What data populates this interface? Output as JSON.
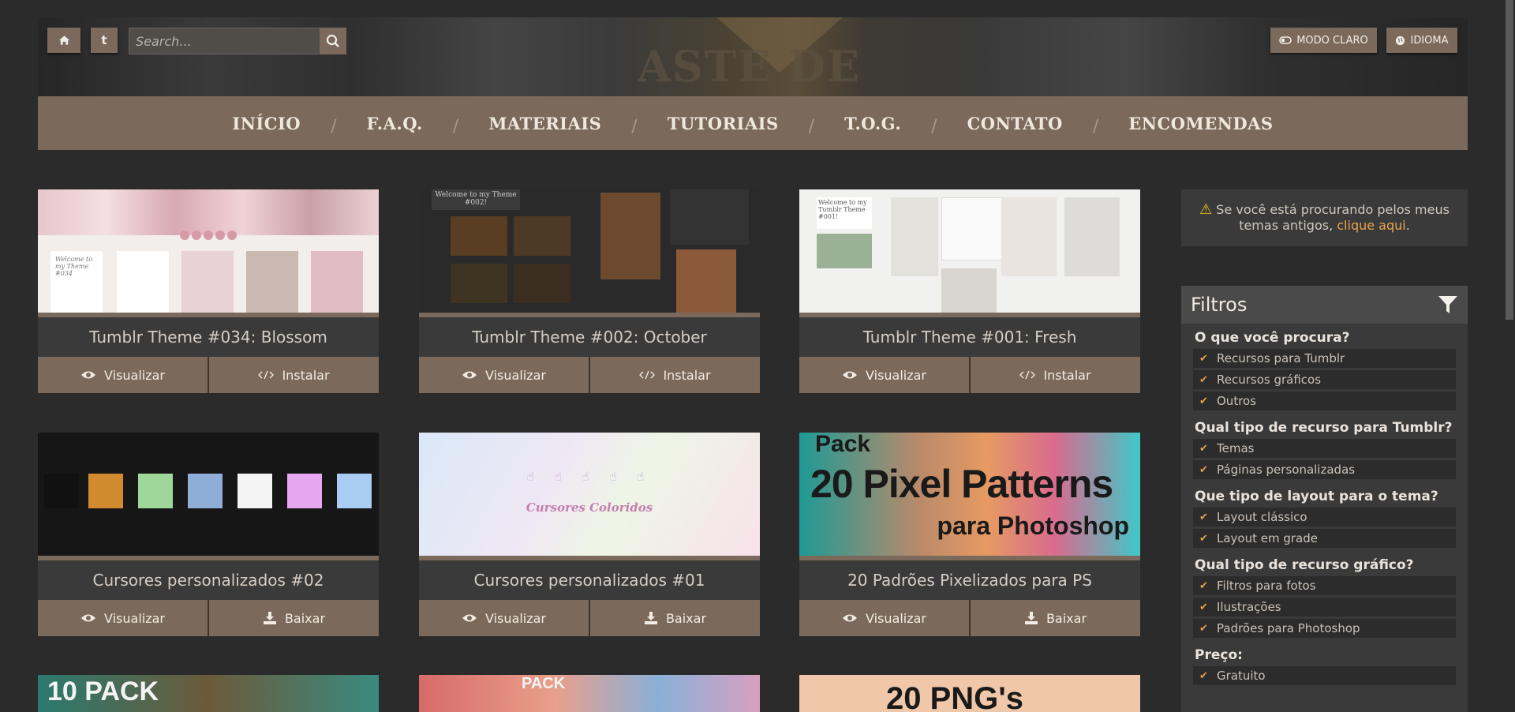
{
  "header": {
    "home_icon": "home-icon",
    "tumblr_label": "t",
    "search_placeholder": "Search...",
    "light_mode_label": "MODO CLARO",
    "language_label": "IDIOMA",
    "logo_text": "ASTE DE"
  },
  "nav": {
    "items": [
      "INÍCIO",
      "F.A.Q.",
      "MATERIAIS",
      "TUTORIAIS",
      "T.O.G.",
      "CONTATO",
      "ENCOMENDAS"
    ],
    "separator": "/"
  },
  "cards": [
    {
      "title": "Tumblr Theme #034: Blossom",
      "view": "Visualizar",
      "action": "Instalar",
      "action_icon": "code-icon"
    },
    {
      "title": "Tumblr Theme #002: October",
      "view": "Visualizar",
      "action": "Instalar",
      "action_icon": "code-icon"
    },
    {
      "title": "Tumblr Theme #001: Fresh",
      "view": "Visualizar",
      "action": "Instalar",
      "action_icon": "code-icon"
    },
    {
      "title": "Cursores personalizados #02",
      "view": "Visualizar",
      "action": "Baixar",
      "action_icon": "download-icon"
    },
    {
      "title": "Cursores personalizados #01",
      "view": "Visualizar",
      "action": "Baixar",
      "action_icon": "download-icon"
    },
    {
      "title": "20 Padrões Pixelizados para PS",
      "view": "Visualizar",
      "action": "Baixar",
      "action_icon": "download-icon"
    }
  ],
  "thumb_text": {
    "blossom_welcome": "Welcome to my Theme #034",
    "october_welcome": "Welcome to my Theme #002!",
    "fresh_welcome": "Welcome to my Tumblr Theme #001!",
    "cursors01": "Cursores Coloridos",
    "patterns_pack": "Pack",
    "patterns_title": "20 Pixel Patterns",
    "patterns_sub": "para Photoshop",
    "row3_a": "10 PACK",
    "row3_b": "PACK",
    "row3_c": "20 PNG's"
  },
  "notice": {
    "text": "Se você está procurando pelos meus temas antigos,",
    "link": "clique aqui",
    "end": "."
  },
  "filters": {
    "title": "Filtros",
    "groups": [
      {
        "title": "O que você procura?",
        "options": [
          "Recursos para Tumblr",
          "Recursos gráficos",
          "Outros"
        ]
      },
      {
        "title": "Qual tipo de recurso para Tumblr?",
        "options": [
          "Temas",
          "Páginas personalizadas"
        ]
      },
      {
        "title": "Que tipo de layout para o tema?",
        "options": [
          "Layout clássico",
          "Layout em grade"
        ]
      },
      {
        "title": "Qual tipo de recurso gráfico?",
        "options": [
          "Filtros para fotos",
          "Ilustrações",
          "Padrões para Photoshop"
        ]
      },
      {
        "title": "Preço:",
        "options": [
          "Gratuito"
        ]
      }
    ]
  },
  "colors": {
    "accent": "#7b6a5b",
    "link": "#e8a24c",
    "background": "#2b2b2b",
    "panel": "#3a3a3a"
  }
}
